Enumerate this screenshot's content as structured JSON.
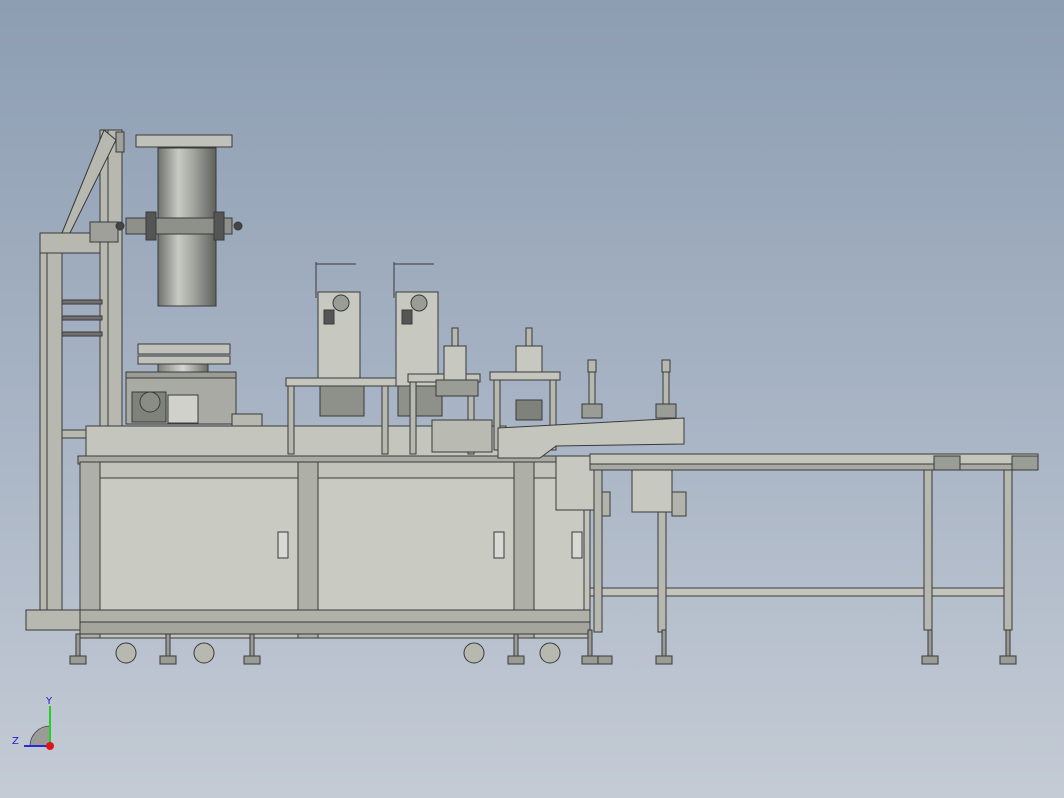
{
  "viewport": {
    "background_top": "#8d9db2",
    "background_bottom": "#c4cbd5"
  },
  "model": {
    "frame_color": "#b7b8b0",
    "panel_color": "#c9cac2",
    "outline_color": "#3a3a3a",
    "roll_color": "#8e908a"
  },
  "triad": {
    "y_label": "Y",
    "z_label": "Z",
    "y_color": "#1fd21f",
    "z_color": "#2a2ad6",
    "x_color": "#e01616"
  }
}
